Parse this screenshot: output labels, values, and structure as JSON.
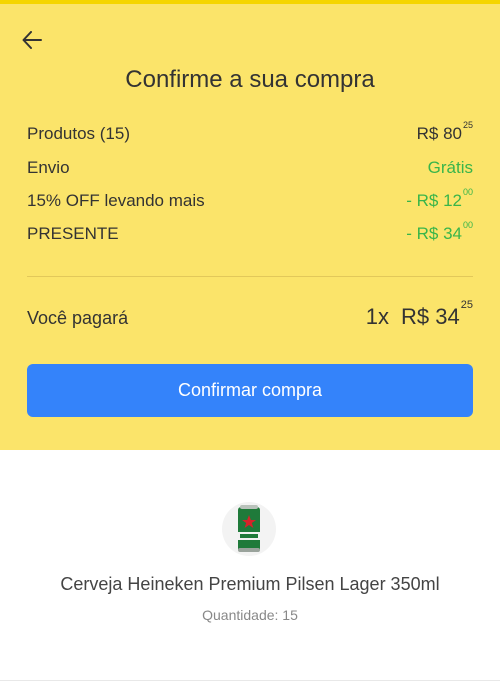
{
  "header": {
    "back_icon": "arrow-left-icon",
    "title": "Confirme a sua compra"
  },
  "summary": {
    "items": [
      {
        "label": "Produtos (15)",
        "prefix": "R$ ",
        "int": "80",
        "cents": "25",
        "free_text": "",
        "color": "#333333"
      },
      {
        "label": "Envio",
        "prefix": "",
        "int": "",
        "cents": "",
        "free_text": "Grátis",
        "color": "#39b54a"
      },
      {
        "label": "15% OFF levando mais",
        "prefix": "- R$ ",
        "int": "12",
        "cents": "00",
        "free_text": "",
        "color": "#39b54a"
      },
      {
        "label": "PRESENTE",
        "prefix": "- R$ ",
        "int": "34",
        "cents": "00",
        "free_text": "",
        "color": "#39b54a"
      }
    ]
  },
  "payment": {
    "label": "Você pagará",
    "installments": "1x",
    "prefix": "R$ ",
    "int": "34",
    "cents": "25"
  },
  "confirm_button": {
    "label": "Confirmar compra",
    "color": "#3483fa"
  },
  "product": {
    "image_icon": "beer-can-icon",
    "name": "Cerveja Heineken Premium Pilsen Lager 350ml",
    "quantity": "Quantidade: 15"
  },
  "colors": {
    "header_bg": "#fbe46a",
    "accent_green": "#39b54a",
    "button_blue": "#3483fa"
  }
}
